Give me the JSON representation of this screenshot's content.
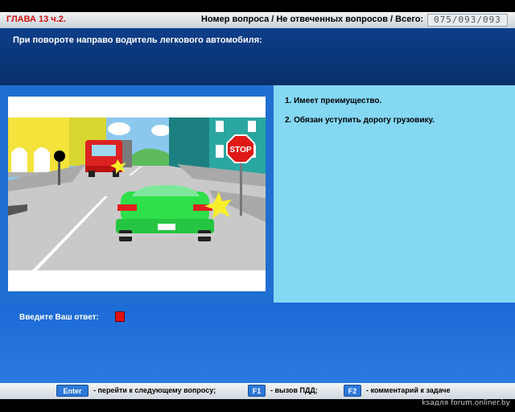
{
  "header": {
    "chapter": "ГЛАВА 13 ч.2.",
    "question_info_label": "Номер вопроса / Не отвеченных вопросов / Всего:",
    "counter": "075/093/093"
  },
  "question": {
    "text": "При повороте направо водитель легкового автомобиля:"
  },
  "answers": [
    {
      "label": "1.  Имеет преимущество."
    },
    {
      "label": "2.  Обязан уступить дорогу грузовику."
    }
  ],
  "input": {
    "prompt": "Введите Ваш ответ:"
  },
  "footer": {
    "keys": [
      {
        "key": "Enter",
        "desc": "- перейти к следующему вопросу;"
      },
      {
        "key": "F1",
        "desc": "- вызов ПДД;"
      },
      {
        "key": "F2",
        "desc": "- комментарий к задаче"
      }
    ]
  },
  "scene": {
    "stop_sign_text": "STOP"
  },
  "watermark": "ksaдля forum.onliner.by",
  "colors": {
    "chapter_red": "#d01010",
    "question_bg": "#0c3f8a",
    "answers_bg": "#84d8f3",
    "accent_blue": "#2c78d8",
    "answer_box_red": "#e01010"
  }
}
